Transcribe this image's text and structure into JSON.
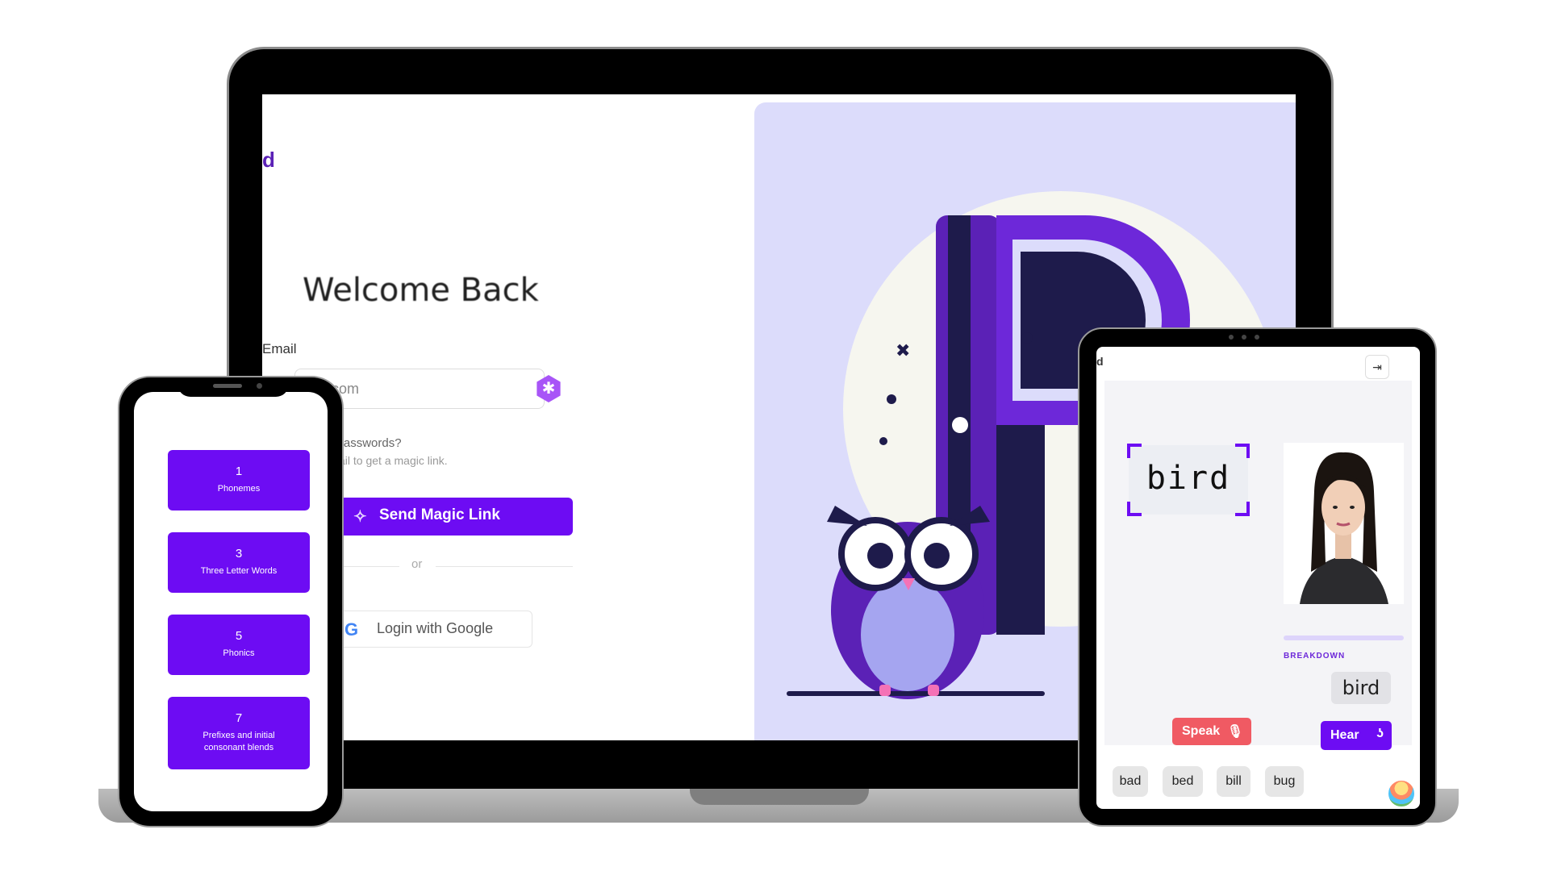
{
  "laptop": {
    "logo": "d",
    "title": "Welcome Back",
    "email_label": "Email",
    "email_placeholder": "ple.com",
    "hint_line1": "g passwords?",
    "hint_line2": "ail to get a magic link.",
    "magic_link_label": "Send Magic Link",
    "or_label": "or",
    "google_label": "Login with Google",
    "accent": "#6d0cf3"
  },
  "phone": {
    "lessons": [
      {
        "number": "1",
        "name": "Phonemes"
      },
      {
        "number": "3",
        "name": "Three Letter Words"
      },
      {
        "number": "5",
        "name": "Phonics"
      },
      {
        "number": "7",
        "name": "Prefixes and initial consonant blends"
      }
    ]
  },
  "tablet": {
    "corner_text": "d",
    "word": "bird",
    "breakdown_label": "BREAKDOWN",
    "syllable": "bird",
    "speak_label": "Speak",
    "hear_label": "Hear",
    "word_chips": [
      "bad",
      "bed",
      "bill",
      "bug"
    ],
    "speak_color": "#f05a63"
  }
}
